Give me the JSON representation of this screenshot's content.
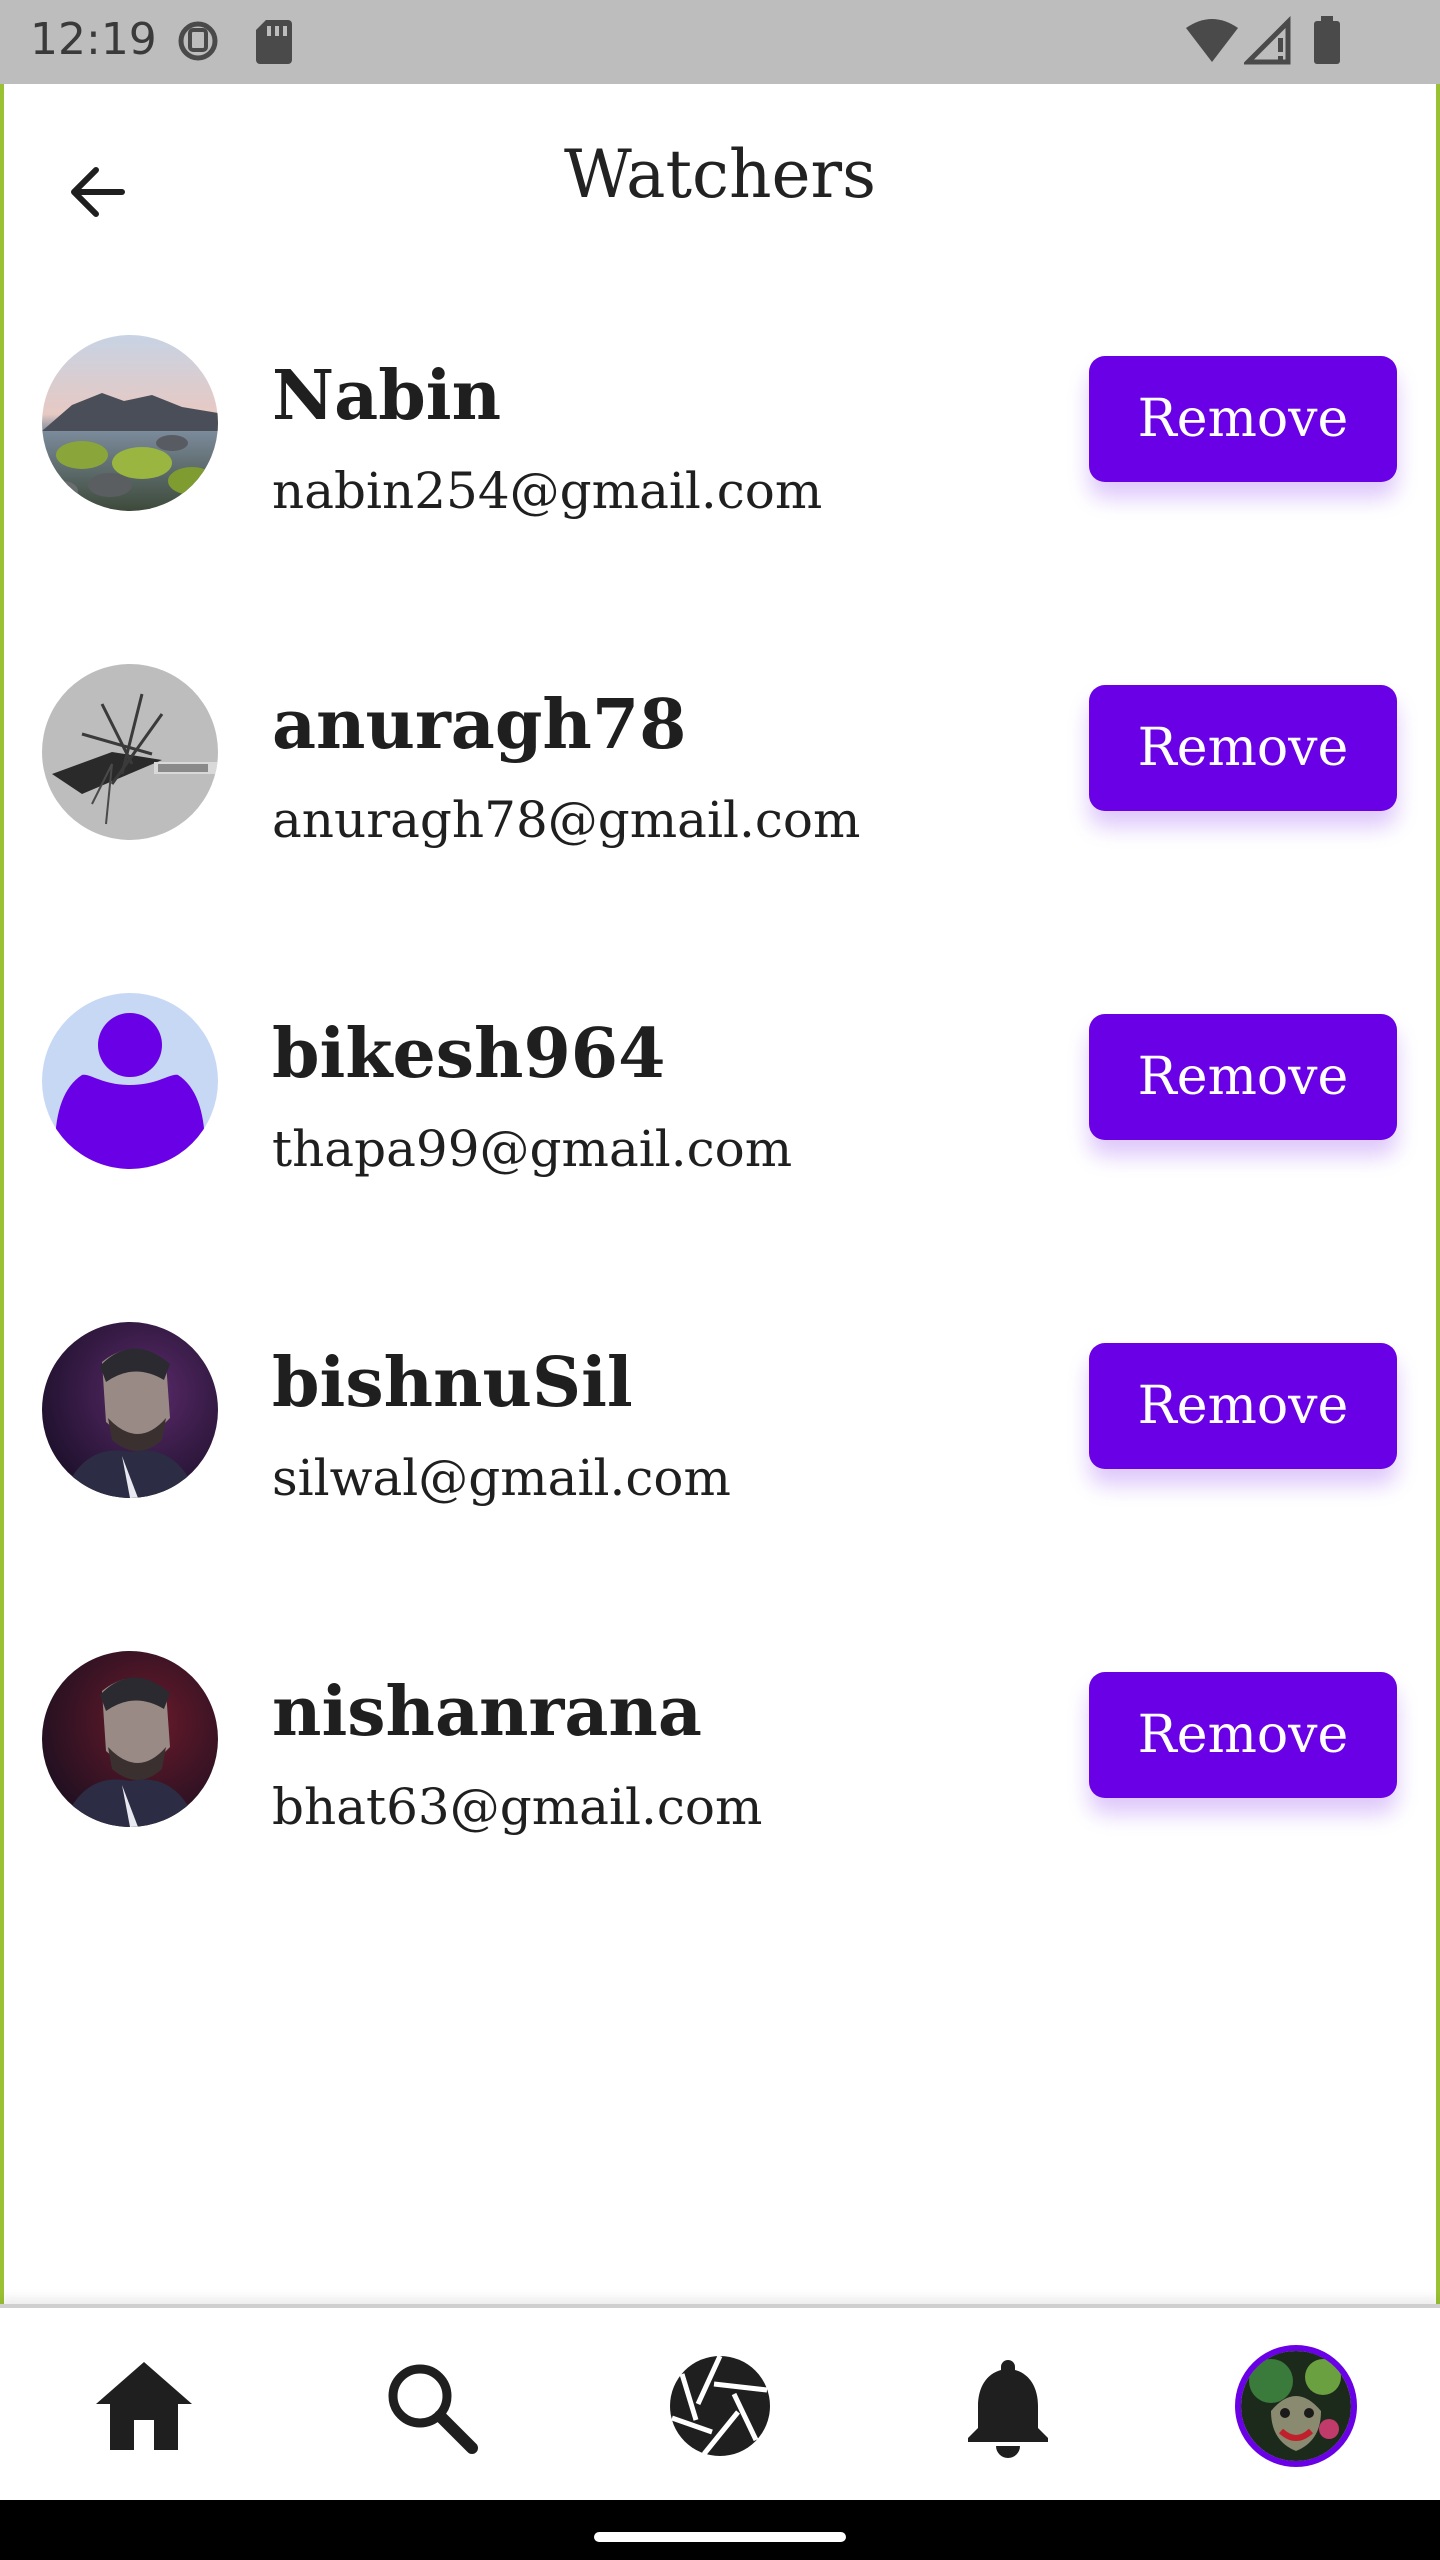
{
  "status_bar": {
    "time": "12:19",
    "icons": [
      "sim-manager-icon",
      "sd-card-icon",
      "wifi-icon",
      "signal-icon",
      "battery-icon"
    ]
  },
  "app_bar": {
    "title": "Watchers",
    "back_icon": "arrow-back-icon"
  },
  "watchers": [
    {
      "name": "Nabin",
      "email": "nabin254@gmail.com",
      "avatar": "landscape-photo",
      "action": "Remove"
    },
    {
      "name": "anuragh78",
      "email": "anuragh78@gmail.com",
      "avatar": "abstract-art",
      "action": "Remove"
    },
    {
      "name": "bikesh964",
      "email": "thapa99@gmail.com",
      "avatar": "default-person",
      "action": "Remove"
    },
    {
      "name": "bishnuSil",
      "email": "silwal@gmail.com",
      "avatar": "portrait-photo",
      "action": "Remove"
    },
    {
      "name": "nishanrana",
      "email": "bhat63@gmail.com",
      "avatar": "portrait-photo",
      "action": "Remove"
    }
  ],
  "bottom_nav": {
    "items": [
      "home-icon",
      "search-icon",
      "camera-shutter-icon",
      "bell-icon",
      "profile-avatar"
    ]
  },
  "colors": {
    "accent": "#6a00e6",
    "status_bar": "#bdbdbd",
    "frame": "#9ac033"
  }
}
